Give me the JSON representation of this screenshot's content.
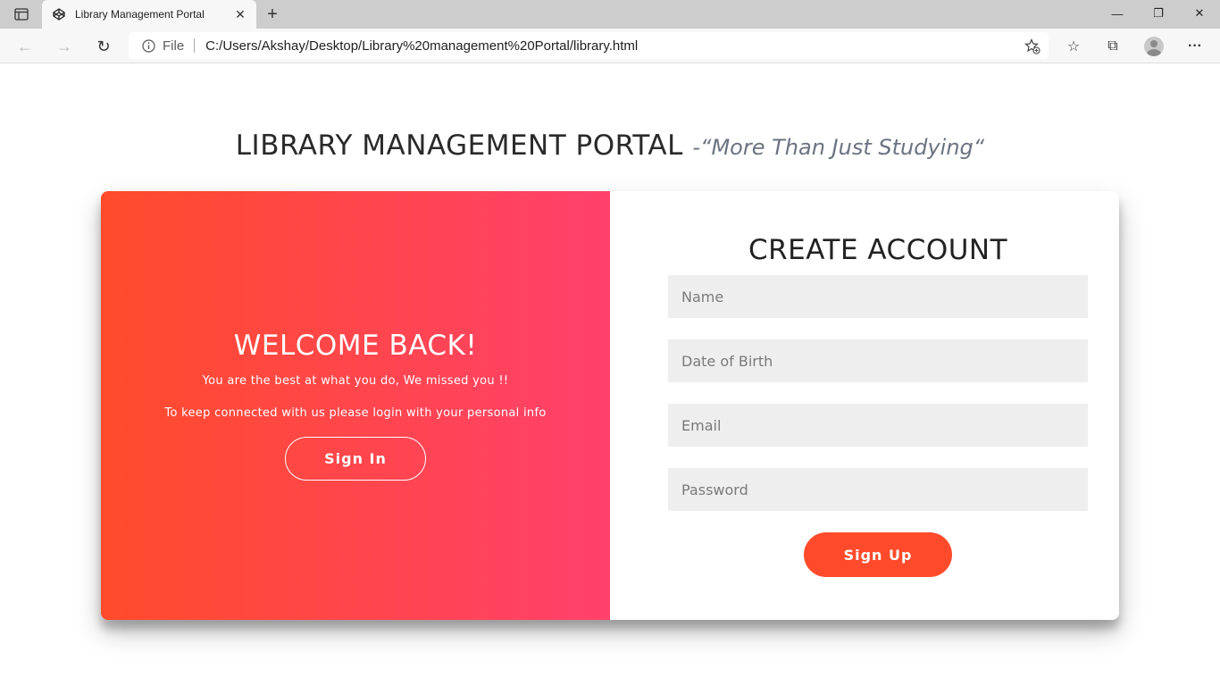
{
  "browser": {
    "tab": {
      "title": "Library Management Portal",
      "close_glyph": "✕"
    },
    "new_tab_glyph": "+",
    "window_controls": {
      "minimize": "—",
      "restore": "❐",
      "close": "✕"
    },
    "nav": {
      "back": "←",
      "forward": "→",
      "refresh": "↻"
    },
    "address": {
      "scheme_label": "File",
      "url": "C:/Users/Akshay/Desktop/Library%20management%20Portal/library.html"
    },
    "toolbar_icons": {
      "favorites": "☆",
      "collections": "⧉",
      "more": "···"
    }
  },
  "page": {
    "heading": "LIBRARY MANAGEMENT PORTAL",
    "tagline": "-“More Than Just Studying“"
  },
  "welcome_panel": {
    "title": "WELCOME BACK!",
    "line1": "You are the best at what you do, We missed you !!",
    "line2": "To keep connected with us please login with your personal info",
    "sign_in_label": "Sign In",
    "gradient_start": "#ff4b2b",
    "gradient_end": "#ff416c"
  },
  "signup_form": {
    "title": "CREATE ACCOUNT",
    "fields": [
      {
        "placeholder": "Name",
        "value": ""
      },
      {
        "placeholder": "Date of Birth",
        "value": ""
      },
      {
        "placeholder": "Email",
        "value": ""
      },
      {
        "placeholder": "Password",
        "value": ""
      }
    ],
    "submit_label": "Sign Up",
    "accent_color": "#ff4b2b"
  }
}
